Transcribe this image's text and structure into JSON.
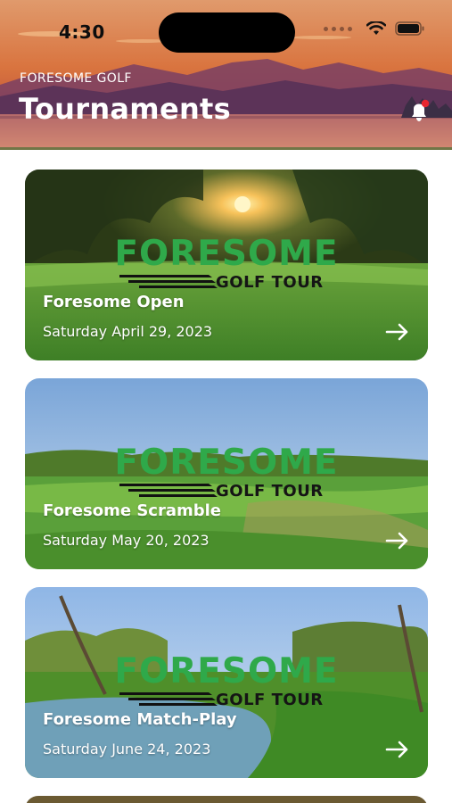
{
  "status": {
    "time": "4:30"
  },
  "header": {
    "brand": "FORESOME GOLF",
    "title": "Tournaments"
  },
  "logo": {
    "word": "FORESOME",
    "sub": "GOLF TOUR"
  },
  "tournaments": [
    {
      "name": "Foresome Open",
      "date": "Saturday April 29, 2023"
    },
    {
      "name": "Foresome Scramble",
      "date": "Saturday May 20, 2023"
    },
    {
      "name": "Foresome Match-Play",
      "date": "Saturday June 24, 2023"
    }
  ],
  "colors": {
    "logo_green": "#2fa94a",
    "notification_dot": "#e8262f"
  },
  "icons": [
    "wifi-icon",
    "battery-icon",
    "bell-icon",
    "arrow-right-icon"
  ]
}
